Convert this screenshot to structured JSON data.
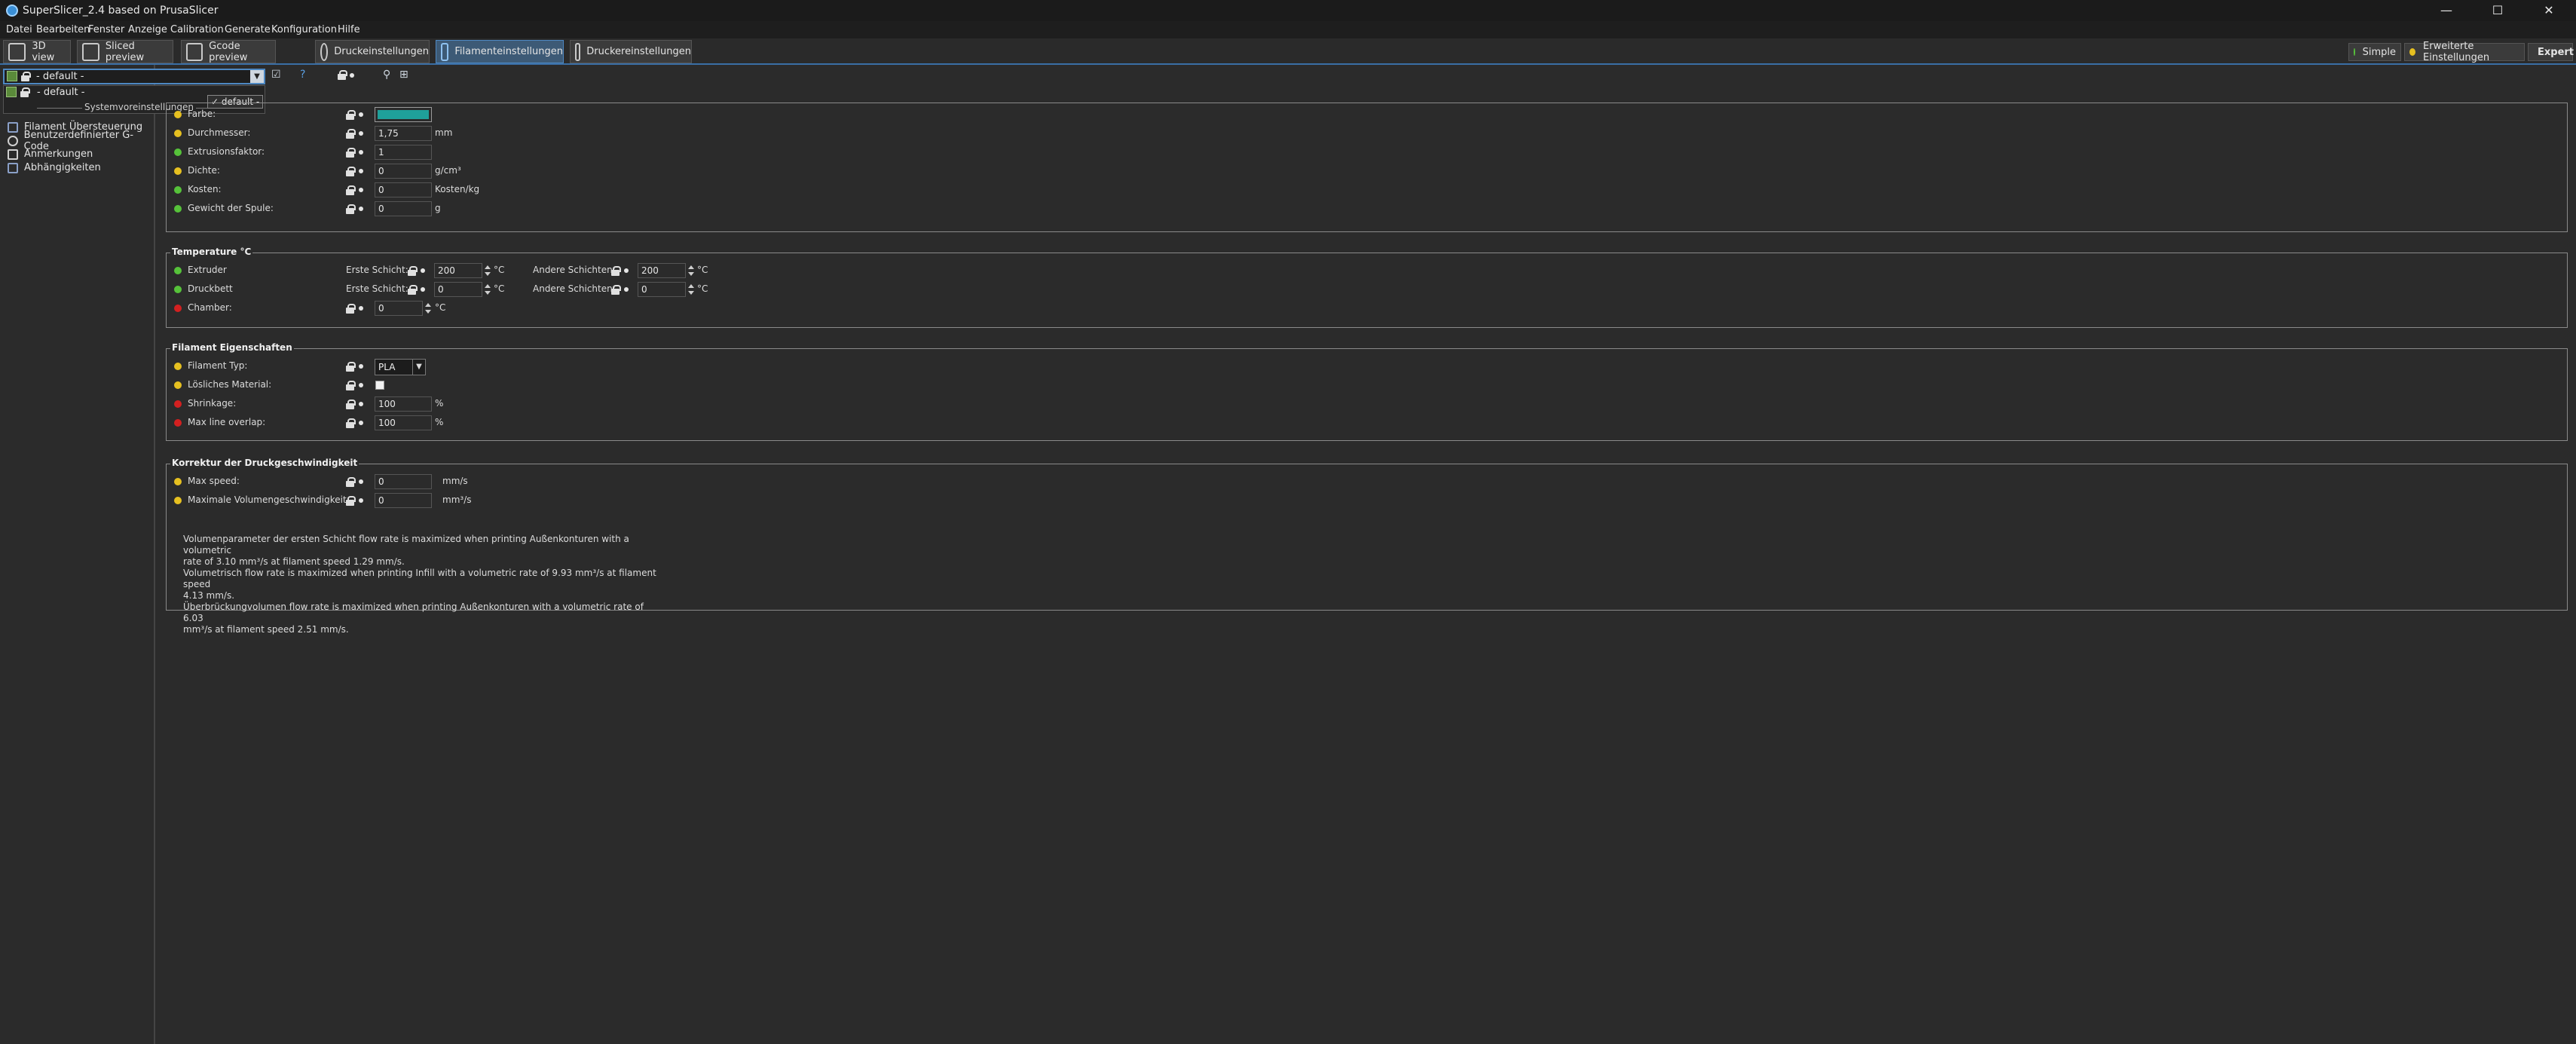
{
  "window": {
    "title": "SuperSlicer_2.4  based on PrusaSlicer",
    "controls": [
      "—",
      "☐",
      "✕"
    ]
  },
  "menu": [
    "Datei",
    "Bearbeiten",
    "Fenster",
    "Anzeige",
    "Calibration",
    "Generate",
    "Konfiguration",
    "Hilfe"
  ],
  "tabs": [
    {
      "label": "3D view",
      "icon": "cube-icon"
    },
    {
      "label": "Sliced preview",
      "icon": "layers-icon"
    },
    {
      "label": "Gcode preview",
      "icon": "gcode-icon"
    },
    {
      "label": "Druckeinstellungen",
      "icon": "gear-icon"
    },
    {
      "label": "Filamenteinstellungen",
      "icon": "spool-icon",
      "active": true
    },
    {
      "label": "Druckereinstellungen",
      "icon": "printer-icon"
    }
  ],
  "modes": [
    {
      "label": "Simple",
      "color": "#56c23a"
    },
    {
      "label": "Erweiterte Einstellungen",
      "color": "#e6c020"
    },
    {
      "label": "Expert",
      "color": "#d32020",
      "active": true
    }
  ],
  "preset": {
    "selected": "- default -",
    "dropdown_item": "- default -",
    "system_presets_label": "Systemvoreinstellungen",
    "tooltip": "✓ default -"
  },
  "sidebar": {
    "items": [
      {
        "label": "Filament Übersteuerung",
        "icon": "override-icon"
      },
      {
        "label": "Benutzerdefinierter G-Code",
        "icon": "gcode-icon"
      },
      {
        "label": "Anmerkungen",
        "icon": "notes-icon"
      },
      {
        "label": "Abhängigkeiten",
        "icon": "dependencies-icon"
      }
    ]
  },
  "filament": {
    "farbe": {
      "label": "Farbe:",
      "color": "#1fa09a"
    },
    "durchmesser": {
      "label": "Durchmesser:",
      "value": "1,75",
      "unit": "mm"
    },
    "extrusionsfaktor": {
      "label": "Extrusionsfaktor:",
      "value": "1"
    },
    "dichte": {
      "label": "Dichte:",
      "value": "0",
      "unit": "g/cm³"
    },
    "kosten": {
      "label": "Kosten:",
      "value": "0",
      "unit": "Kosten/kg"
    },
    "gewicht": {
      "label": "Gewicht der Spule:",
      "value": "0",
      "unit": "g"
    }
  },
  "temperature": {
    "title": "Temperature °C",
    "extruder": {
      "label": "Extruder",
      "first_label": "Erste Schicht:",
      "first_value": "200",
      "other_label": "Andere Schichten:",
      "other_value": "200",
      "unit": "°C"
    },
    "druckbett": {
      "label": "Druckbett",
      "first_label": "Erste Schicht:",
      "first_value": "0",
      "other_label": "Andere Schichten:",
      "other_value": "0",
      "unit": "°C"
    },
    "chamber": {
      "label": "Chamber:",
      "value": "0",
      "unit": "°C"
    }
  },
  "properties": {
    "title": "Filament Eigenschaften",
    "typ": {
      "label": "Filament Typ:",
      "value": "PLA"
    },
    "loeslich": {
      "label": "Lösliches Material:"
    },
    "shrinkage": {
      "label": "Shrinkage:",
      "value": "100",
      "unit": "%"
    },
    "overlap": {
      "label": "Max line overlap:",
      "value": "100",
      "unit": "%"
    }
  },
  "speed": {
    "title": "Korrektur der Druckgeschwindigkeit",
    "max_speed": {
      "label": "Max speed:",
      "value": "0",
      "unit": "mm/s"
    },
    "max_vol": {
      "label": "Maximale Volumengeschwindigkeit:",
      "value": "0",
      "unit": "mm³/s"
    },
    "info": [
      "Volumenparameter der ersten Schicht flow rate is maximized  when printing Außenkonturen with a volumetric",
      "rate of 3.10 mm³/s at filament speed 1.29 mm/s.",
      "Volumetrisch flow rate is maximized  when printing Infill with a volumetric rate of 9.93 mm³/s at filament speed",
      "4.13 mm/s.",
      "Überbrückungvolumen flow rate is maximized  when printing Außenkonturen with a volumetric rate of 6.03",
      "mm³/s at filament speed 2.51 mm/s."
    ]
  }
}
